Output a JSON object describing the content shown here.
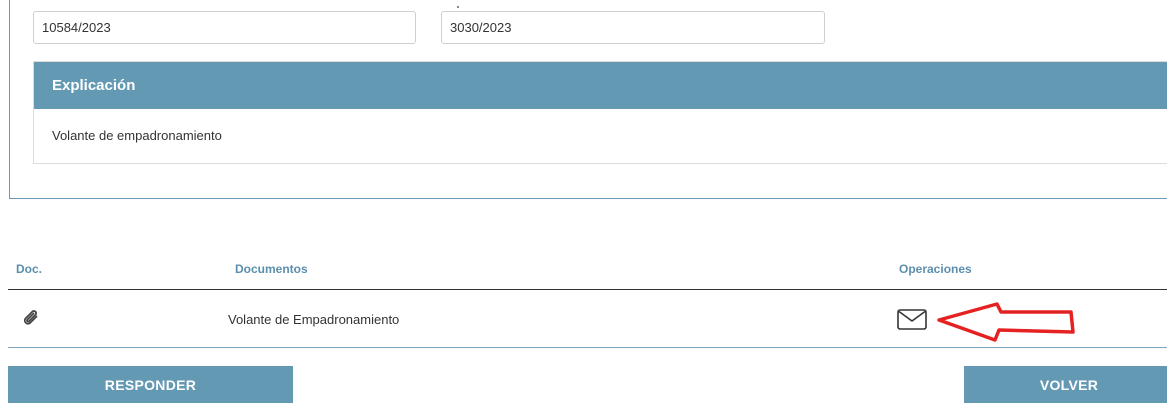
{
  "fields": {
    "expediente_value": "10584/2023",
    "registro_value": "3030/2023"
  },
  "explicacion": {
    "title": "Explicación",
    "text": "Volante de empadronamiento"
  },
  "documents_table": {
    "headers": {
      "doc": "Doc.",
      "documentos": "Documentos",
      "operaciones": "Operaciones"
    },
    "rows": [
      {
        "icon": "paperclip-icon",
        "name": "Volante de Empadronamiento",
        "operation_icon": "envelope-icon"
      }
    ]
  },
  "annotation": {
    "arrow_color": "#e52222"
  },
  "buttons": {
    "responder": "RESPONDER",
    "volver": "VOLVER"
  },
  "colors": {
    "accent": "#6499b4",
    "header_text": "#5b8fad"
  }
}
